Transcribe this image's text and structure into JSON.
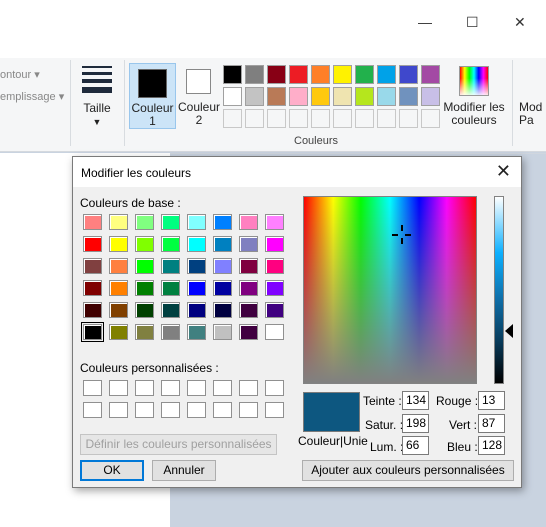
{
  "ribbon": {
    "contour_label": "ontour ▾",
    "remplissage_label": "emplissage ▾",
    "taille_label": "Taille",
    "couleur1_label": "Couleur 1",
    "couleur2_label": "Couleur 2",
    "edit_colors_label": "Modifier les couleurs",
    "cut_label": "Mod Pa",
    "group_label": "Couleurs",
    "palette_row1": [
      "#000000",
      "#7f7f7f",
      "#880015",
      "#ed1c24",
      "#ff7f27",
      "#fff200",
      "#22b14c",
      "#00a2e8",
      "#3f48cc",
      "#a349a4"
    ],
    "palette_row2": [
      "#ffffff",
      "#c3c3c3",
      "#b97a57",
      "#ffaec9",
      "#ffc90e",
      "#efe4b0",
      "#b5e61d",
      "#99d9ea",
      "#7092be",
      "#c8bfe7"
    ]
  },
  "dialog": {
    "title": "Modifier les couleurs",
    "close_glyph": "✕",
    "base_label": "Couleurs de base :",
    "custom_label": "Couleurs personnalisées :",
    "define_button": "Définir les couleurs personnalisées >>",
    "ok_button": "OK",
    "cancel_button": "Annuler",
    "add_button": "Ajouter aux couleurs personnalisées",
    "preview_label": "Couleur|Unie",
    "fields": {
      "teinte_label": "Teinte :",
      "teinte_value": "134",
      "satur_label": "Satur. :",
      "satur_value": "198",
      "lum_label": "Lum. :",
      "lum_value": "66",
      "rouge_label": "Rouge :",
      "rouge_value": "13",
      "vert_label": "Vert :",
      "vert_value": "87",
      "bleu_label": "Bleu :",
      "bleu_value": "128"
    },
    "selected_color": "#0d5780",
    "base_colors": [
      [
        "#ff8080",
        "#ffff80",
        "#80ff80",
        "#00ff80",
        "#80ffff",
        "#0080ff",
        "#ff80c0",
        "#ff80ff"
      ],
      [
        "#ff0000",
        "#ffff00",
        "#80ff00",
        "#00ff40",
        "#00ffff",
        "#0080c0",
        "#8080c0",
        "#ff00ff"
      ],
      [
        "#804040",
        "#ff8040",
        "#00ff00",
        "#008080",
        "#004080",
        "#8080ff",
        "#800040",
        "#ff0080"
      ],
      [
        "#800000",
        "#ff8000",
        "#008000",
        "#008040",
        "#0000ff",
        "#0000a0",
        "#800080",
        "#8000ff"
      ],
      [
        "#400000",
        "#804000",
        "#004000",
        "#004040",
        "#000080",
        "#000040",
        "#400040",
        "#400080"
      ],
      [
        "#000000",
        "#808000",
        "#808040",
        "#808080",
        "#408080",
        "#c0c0c0",
        "#400040",
        "#ffffff"
      ]
    ]
  }
}
